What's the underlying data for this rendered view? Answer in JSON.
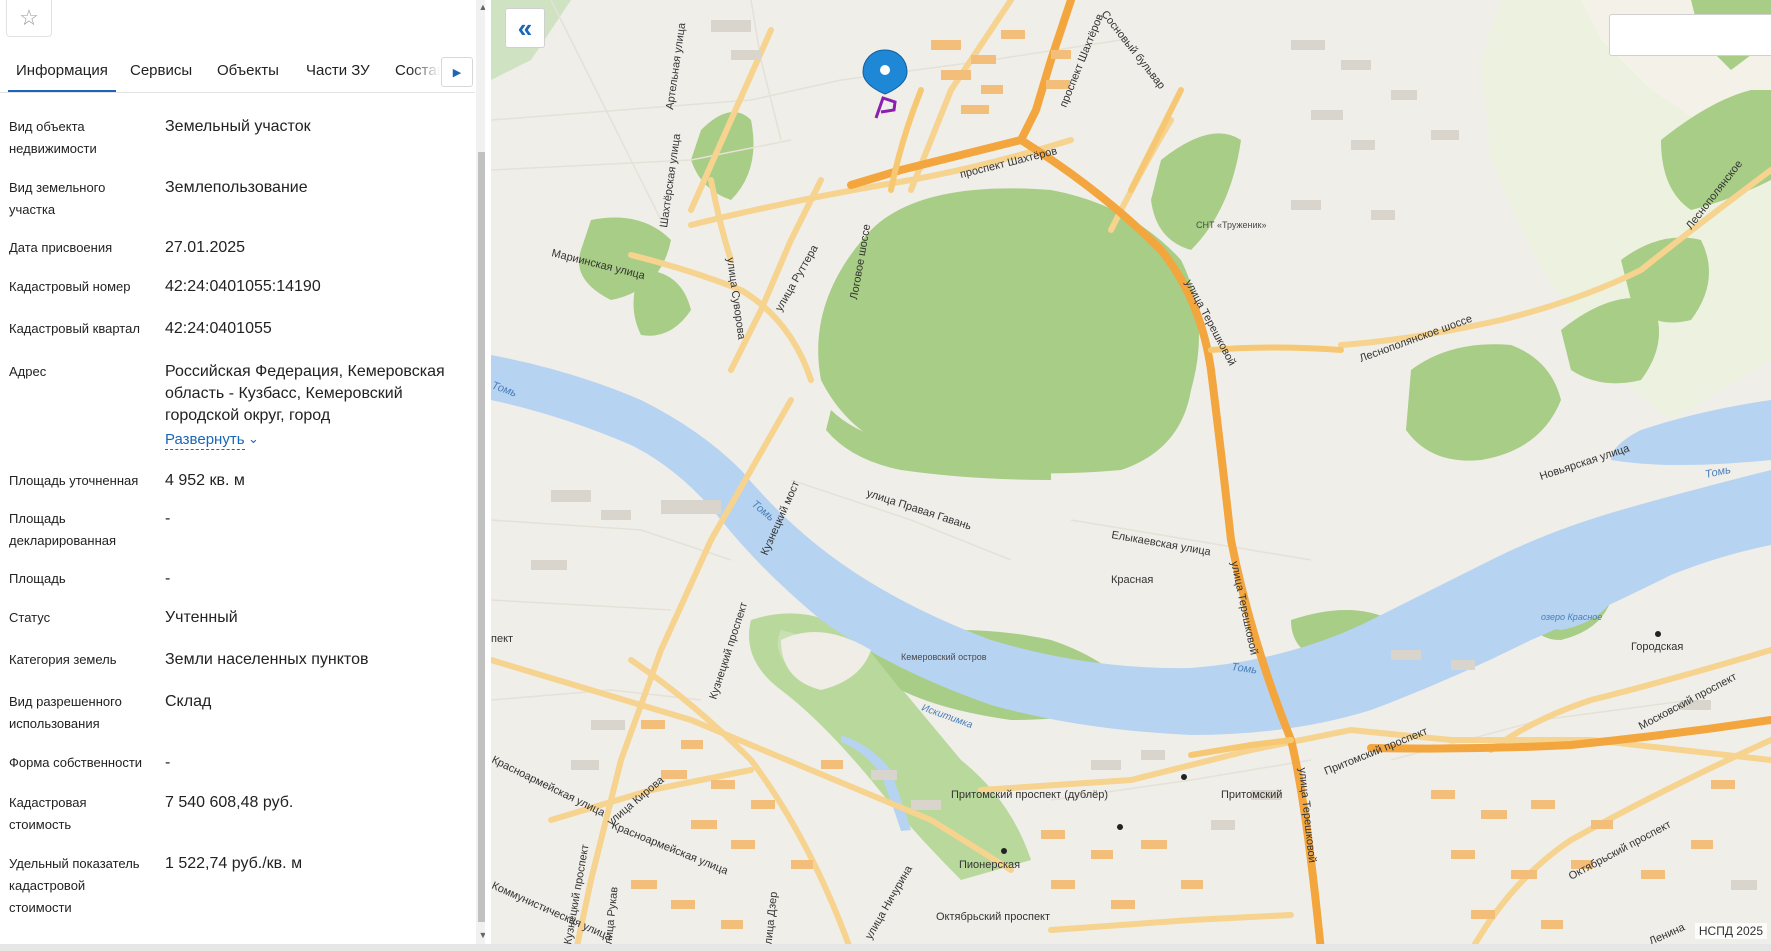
{
  "toolbar": {
    "favorite_icon": "star-icon"
  },
  "tabs": [
    {
      "label": "Информация",
      "active": true
    },
    {
      "label": "Сервисы"
    },
    {
      "label": "Объекты"
    },
    {
      "label": "Части ЗУ"
    },
    {
      "label": "Состав"
    }
  ],
  "tabs_next_icon": "chevron-right-icon",
  "info": [
    {
      "label": "Вид объекта недвижимости",
      "value": "Земельный участок"
    },
    {
      "label": "Вид земельного участка",
      "value": "Землепользование"
    },
    {
      "label": "Дата присвоения",
      "value": "27.01.2025"
    },
    {
      "label": "Кадастровый номер",
      "value": "42:24:0401055:14190"
    },
    {
      "label": "Кадастровый квартал",
      "value": "42:24:0401055"
    },
    {
      "label": "Адрес",
      "value": "Российская Федерация, Кемеровская область - Кузбасс, Кемеровский городской округ, город"
    },
    {
      "label": "Площадь уточненная",
      "value": "4 952 кв. м"
    },
    {
      "label": "Площадь декларированная",
      "value": "-"
    },
    {
      "label": "Площадь",
      "value": "-"
    },
    {
      "label": "Статус",
      "value": "Учтенный"
    },
    {
      "label": "Категория земель",
      "value": "Земли населенных пунктов"
    },
    {
      "label": "Вид разрешенного использования",
      "value": "Склад"
    },
    {
      "label": "Форма собственности",
      "value": "-"
    },
    {
      "label": "Кадастровая стоимость",
      "value": "7 540 608,48 руб."
    },
    {
      "label": "Удельный показатель кадастровой стоимости",
      "value": "1 522,74 руб./кв. м"
    }
  ],
  "address_expand": "Развернуть",
  "map": {
    "collapse_icon": "double-chevron-left-icon",
    "attribution": "НСПД 2025",
    "labels": {
      "pr_shahterov_top": "проспект Шахтёров",
      "pr_shahterov": "проспект Шахтёров",
      "sosnovy": "Сосновый бульвар",
      "artelnaya": "Артельная улица",
      "shahterskaya": "Шахтёрская улица",
      "mariinskaya": "Мариинская улица",
      "suvorova": "улица Суворова",
      "ruttera": "улица Руттера",
      "logovoe": "Логовое шоссе",
      "tereshkovoy_1": "улица Терешковой",
      "tereshkovoy_2": "улица Терешковой",
      "tereshkovoy_3": "улица Терешковой",
      "snt": "СНТ «Труженик»",
      "lesnopolyanskoe": "Леснополянское шоссе",
      "lesnopolyanskoe_2": "Леснополянское",
      "tom_1": "Томь",
      "tom_2": "Томь",
      "tom_3": "Томь",
      "tom_4": "Томь",
      "novoyarskaya": "Новьярская улица",
      "kuznetsky_most": "Кузнецкий мост",
      "pravaya_gavan": "улица Правая Гавань",
      "elykaevskaya": "Елыкаевская улица",
      "krasnaya": "Красная",
      "ozero_krasnoe": "озеро Красное",
      "gorodskaya": "Городская",
      "kemerovsky_ostrov": "Кемеровский остров",
      "iskitimka": "Искитимка",
      "kuznetsky_prospekt": "Кузнецкий проспект",
      "kuznetsky_prospekt_2": "Кузнецкий проспект",
      "pritomsky_dubler": "Притомский проспект (дублёр)",
      "pritomsky_prospekt": "Притомский проспект",
      "pritomsky": "Притомский",
      "pionerskaya": "Пионерская",
      "oktyabrsky": "Октябрьский проспект",
      "oktyabrsky_2": "Октябрьский проспект",
      "moskovsky": "Московский проспект",
      "krasnoarmeyskaya": "Красноармейская улица",
      "krasnoarmeyskaya_2": "Красноармейская улица",
      "kirova": "улица Кирова",
      "kommunisticheskaya": "Коммунистическая улица",
      "kuznetsky_pr_3": "Кузнецкий проспект",
      "rukav": "улица Рукав",
      "dzerzhinskogo": "улица Дзер",
      "nikhurina": "улица Ничурина",
      "lenina": "Ленина",
      "pekt": "пект"
    }
  }
}
